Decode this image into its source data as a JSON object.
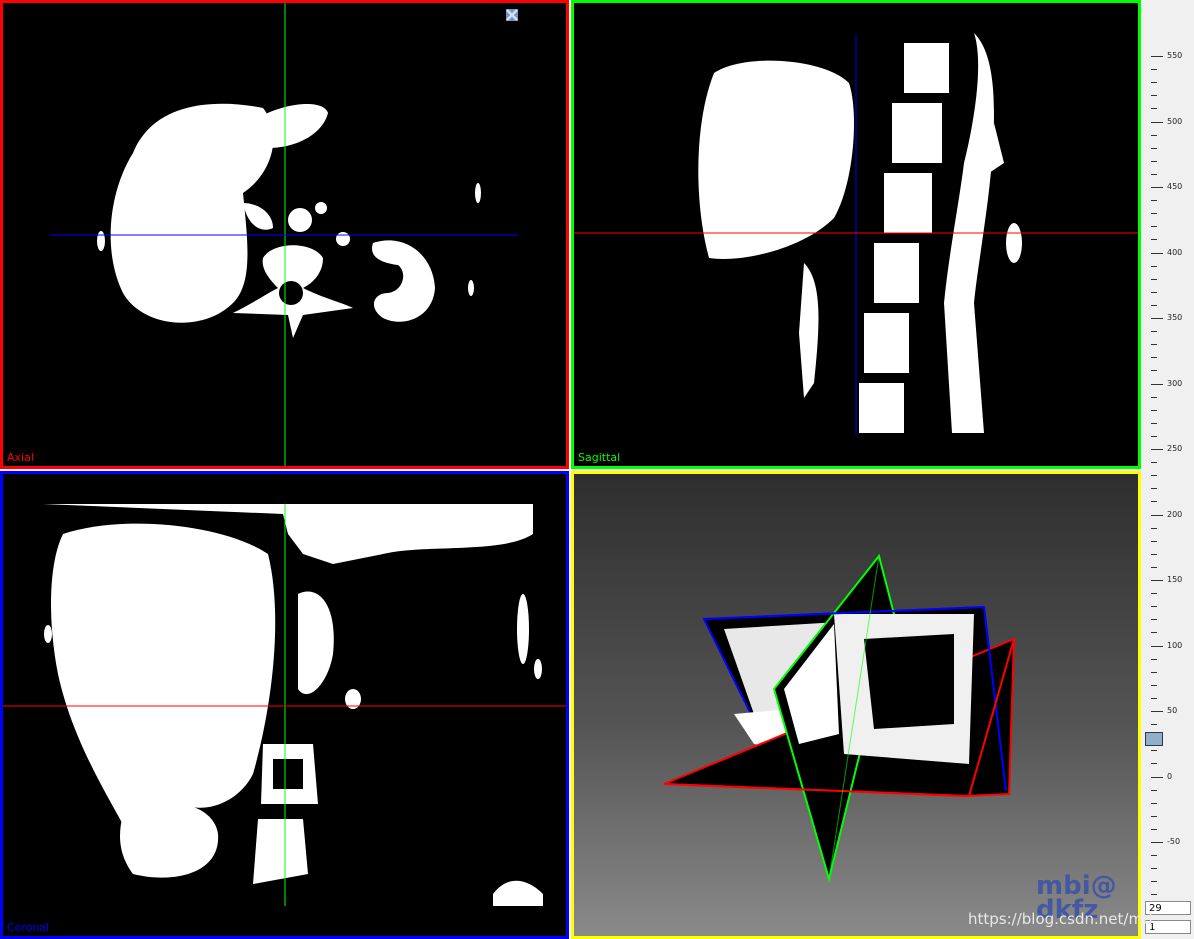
{
  "views": {
    "axial": {
      "label": "Axial",
      "color": "#ff0000"
    },
    "sagittal": {
      "label": "Sagittal",
      "color": "#00ff00"
    },
    "coronal": {
      "label": "Coronal",
      "color": "#0000ff"
    },
    "view3d": {
      "label": "",
      "color": "#ffff00"
    }
  },
  "toolbar": {
    "icons": [
      "crosshair-icon",
      "maximize-icon",
      "tools-icon"
    ]
  },
  "ruler": {
    "ticks": [
      "550",
      "500",
      "450",
      "400",
      "350",
      "300",
      "250",
      "200",
      "150",
      "100",
      "50",
      "0",
      "-50"
    ]
  },
  "spinners": {
    "top": "29",
    "bottom": "1"
  },
  "watermark": {
    "logo": "mbi@\ndkfz",
    "url": "https://blog.csdn.net/md"
  }
}
